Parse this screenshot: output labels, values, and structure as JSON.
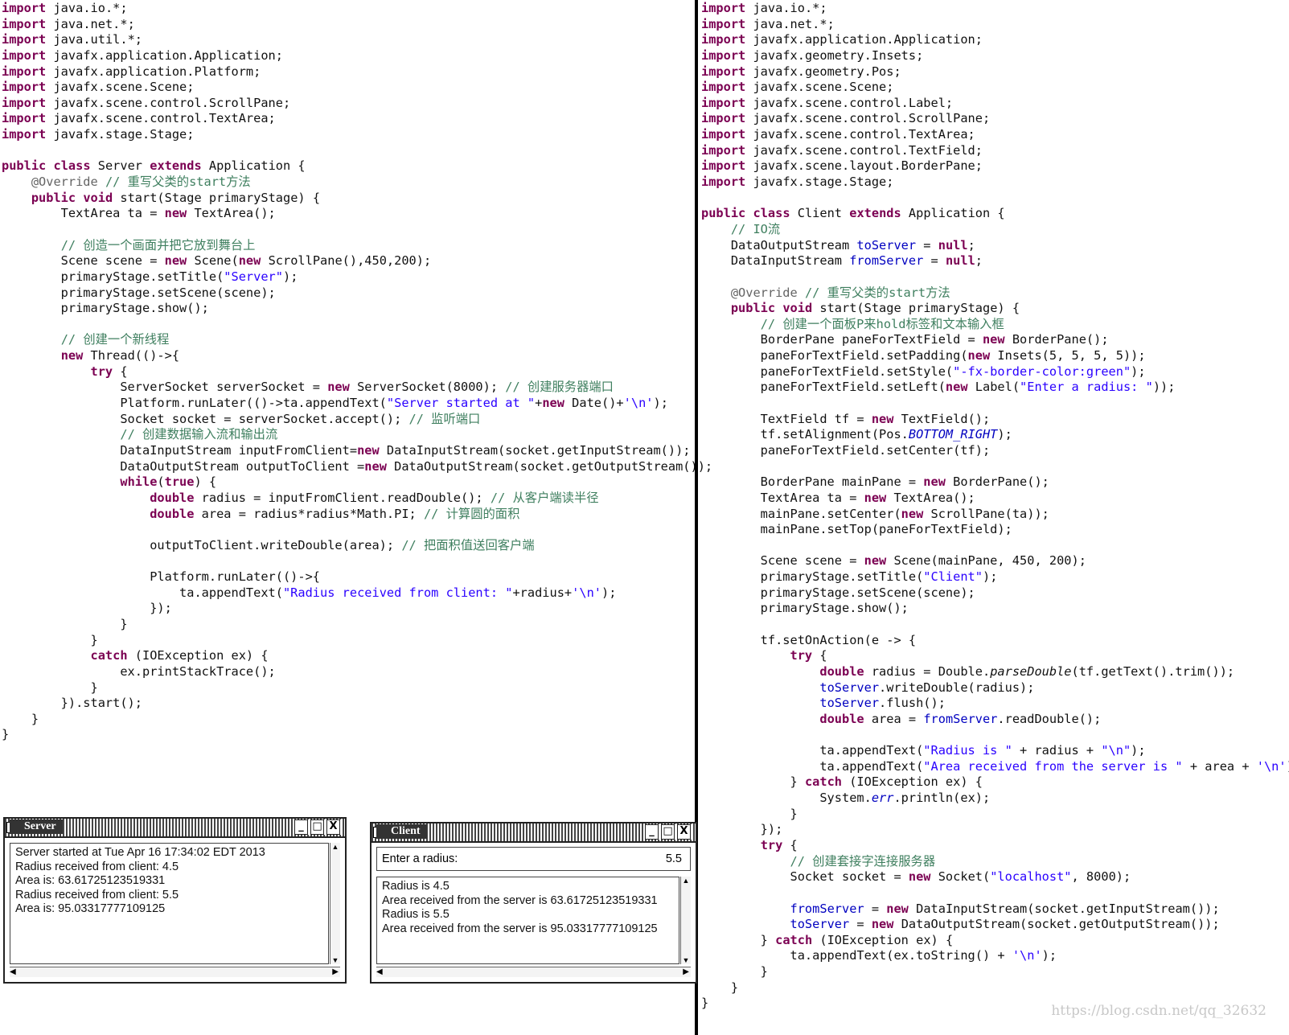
{
  "server_code": [
    "import java.io.*;",
    "import java.net.*;",
    "import java.util.*;",
    "import javafx.application.Application;",
    "import javafx.application.Platform;",
    "import javafx.scene.Scene;",
    "import javafx.scene.control.ScrollPane;",
    "import javafx.scene.control.TextArea;",
    "import javafx.stage.Stage;",
    "",
    "public class Server extends Application {",
    "    @Override // 重写父类的start方法",
    "    public void start(Stage primaryStage) {",
    "        TextArea ta = new TextArea();",
    "",
    "        // 创造一个画面并把它放到舞台上",
    "        Scene scene = new Scene(new ScrollPane(),450,200);",
    "        primaryStage.setTitle(\"Server\");",
    "        primaryStage.setScene(scene);",
    "        primaryStage.show();",
    "",
    "        // 创建一个新线程",
    "        new Thread(()->{",
    "            try {",
    "                ServerSocket serverSocket = new ServerSocket(8000); // 创建服务器端口",
    "                Platform.runLater(()->ta.appendText(\"Server started at \"+new Date()+'\\n');",
    "                Socket socket = serverSocket.accept(); // 监听端口",
    "                // 创建数据输入流和输出流",
    "                DataInputStream inputFromClient=new DataInputStream(socket.getInputStream());",
    "                DataOutputStream outputToClient =new DataOutputStream(socket.getOutputStream());",
    "                while(true) {",
    "                    double radius = inputFromClient.readDouble(); // 从客户端读半径",
    "                    double area = radius*radius*Math.PI; // 计算圆的面积",
    "",
    "                    outputToClient.writeDouble(area); // 把面积值送回客户端",
    "",
    "                    Platform.runLater(()->{",
    "                        ta.appendText(\"Radius received from client: \"+radius+'\\n');",
    "                    });",
    "                }",
    "            }",
    "            catch (IOException ex) {",
    "                ex.printStackTrace();",
    "            }",
    "        }).start();",
    "    }",
    "}"
  ],
  "client_code": [
    "import java.io.*;",
    "import java.net.*;",
    "import javafx.application.Application;",
    "import javafx.geometry.Insets;",
    "import javafx.geometry.Pos;",
    "import javafx.scene.Scene;",
    "import javafx.scene.control.Label;",
    "import javafx.scene.control.ScrollPane;",
    "import javafx.scene.control.TextArea;",
    "import javafx.scene.control.TextField;",
    "import javafx.scene.layout.BorderPane;",
    "import javafx.stage.Stage;",
    "",
    "public class Client extends Application {",
    "    // IO流",
    "    DataOutputStream toServer = null;",
    "    DataInputStream fromServer = null;",
    "",
    "    @Override // 重写父类的start方法",
    "    public void start(Stage primaryStage) {",
    "        // 创建一个面板P来hold标签和文本输入框",
    "        BorderPane paneForTextField = new BorderPane();",
    "        paneForTextField.setPadding(new Insets(5, 5, 5, 5));",
    "        paneForTextField.setStyle(\"-fx-border-color:green\");",
    "        paneForTextField.setLeft(new Label(\"Enter a radius: \"));",
    "",
    "        TextField tf = new TextField();",
    "        tf.setAlignment(Pos.BOTTOM_RIGHT);",
    "        paneForTextField.setCenter(tf);",
    "",
    "        BorderPane mainPane = new BorderPane();",
    "        TextArea ta = new TextArea();",
    "        mainPane.setCenter(new ScrollPane(ta));",
    "        mainPane.setTop(paneForTextField);",
    "",
    "        Scene scene = new Scene(mainPane, 450, 200);",
    "        primaryStage.setTitle(\"Client\");",
    "        primaryStage.setScene(scene);",
    "        primaryStage.show();",
    "",
    "        tf.setOnAction(e -> {",
    "            try {",
    "                double radius = Double.parseDouble(tf.getText().trim());",
    "                toServer.writeDouble(radius);",
    "                toServer.flush();",
    "                double area = fromServer.readDouble();",
    "",
    "                ta.appendText(\"Radius is \" + radius + \"\\n\");",
    "                ta.appendText(\"Area received from the server is \" + area + '\\n');",
    "            } catch (IOException ex) {",
    "                System.err.println(ex);",
    "            }",
    "        });",
    "        try {",
    "            // 创建套接字连接服务器",
    "            Socket socket = new Socket(\"localhost\", 8000);",
    "",
    "            fromServer = new DataInputStream(socket.getInputStream());",
    "            toServer = new DataOutputStream(socket.getOutputStream());",
    "        } catch (IOException ex) {",
    "            ta.appendText(ex.toString() + '\\n');",
    "        }",
    "    }",
    "}"
  ],
  "server_window": {
    "title": "Server",
    "controls": [
      "_",
      "□",
      "X"
    ],
    "lines": [
      "Server started at Tue Apr 16 17:34:02 EDT 2013",
      "Radius received from client: 4.5",
      "Area is: 63.61725123519331",
      "Radius received from client: 5.5",
      "Area is: 95.03317777109125"
    ]
  },
  "client_window": {
    "title": "Client",
    "controls": [
      "_",
      "□",
      "X"
    ],
    "label": "Enter a radius:",
    "field_value": "5.5",
    "lines": [
      "Radius is 4.5",
      "Area received from the server is 63.61725123519331",
      "Radius is 5.5",
      "Area received from the server is 95.03317777109125"
    ]
  },
  "watermark": "https://blog.csdn.net/qq_32632"
}
